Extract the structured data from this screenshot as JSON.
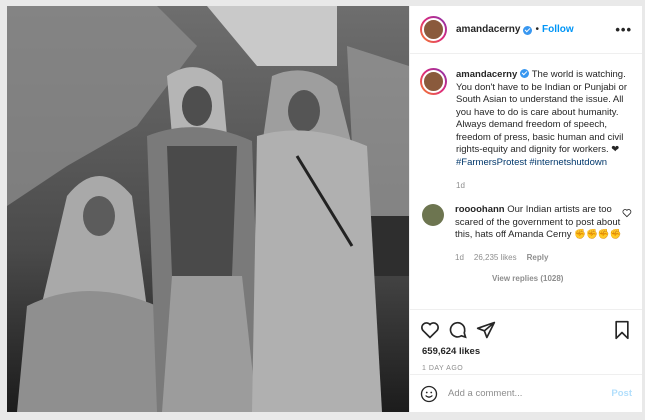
{
  "post": {
    "username": "amandacerny",
    "follow_label": "Follow",
    "separator": "•",
    "more_label": "•••"
  },
  "caption": {
    "username": "amandacerny",
    "text": "The world is watching. You don't have to be Indian or Punjabi or South Asian to understand the issue. All you have to do is care about humanity. Always demand freedom of speech, freedom of press, basic human and civil rights-equity and dignity for workers. ❤",
    "hashtags": "#FarmersProtest #internetshutdown",
    "time": "1d"
  },
  "comment": {
    "username": "roooohann",
    "text": "Our Indian artists are too scared of the government to post about this, hats off Amanda Cerny ✊✊✊✊",
    "time": "1d",
    "likes": "26,235 likes",
    "reply_label": "Reply",
    "view_replies": "View replies (1028)"
  },
  "stats": {
    "likes": "659,624 likes",
    "date": "1 DAY AGO"
  },
  "add_comment": {
    "placeholder": "Add a comment...",
    "post_label": "Post"
  },
  "icons": {
    "like": "heart-icon",
    "comment": "comment-icon",
    "share": "share-icon",
    "save": "bookmark-icon",
    "emoji": "emoji-icon",
    "verified": "verified-badge-icon"
  }
}
